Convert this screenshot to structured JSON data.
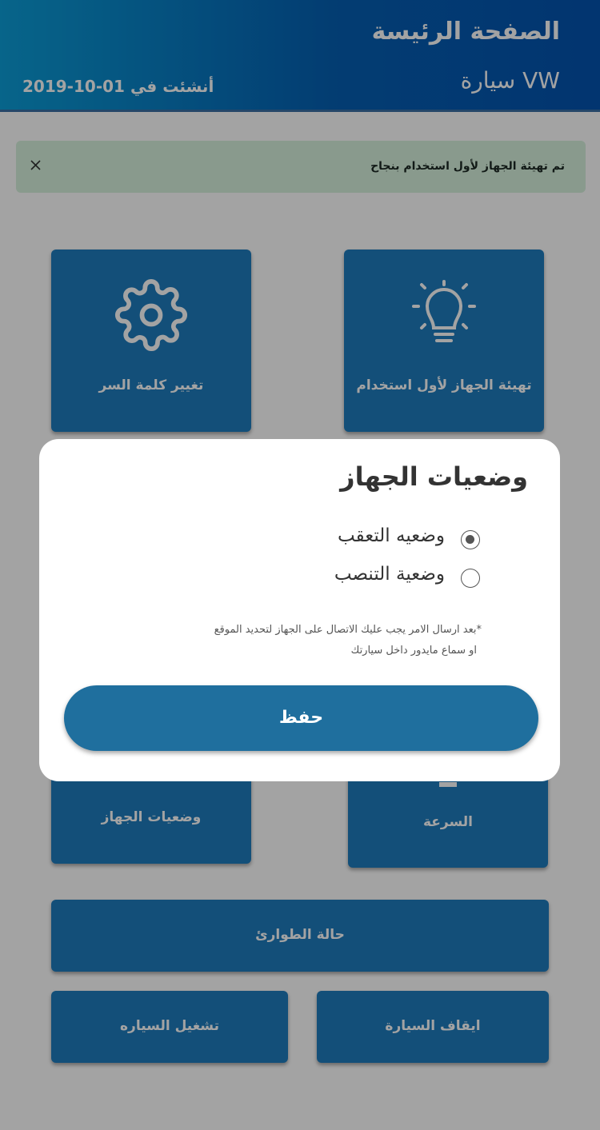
{
  "header": {
    "title": "الصفحة الرئيسة",
    "car": "سيارة VW",
    "created": "أنشئت في  01-10-2019"
  },
  "alert": {
    "message": "تم تهيئة الجهاز لأول استخدام بنجاح",
    "close_icon": "close-icon"
  },
  "tiles": {
    "change_password": "تغيير كلمة السر",
    "init_device": "تهيئة الجهاز لأول استخدام",
    "device_modes": "وضعيات الجهاز",
    "speed": "السرعة",
    "emergency": "حالة الطوارئ",
    "start_car": "تشغيل السياره",
    "stop_car": "ايقاف السيارة"
  },
  "icons": {
    "settings": "gear-icon",
    "bulb": "lightbulb-icon"
  },
  "modal": {
    "title": "وضعيات الجهاز",
    "options": [
      {
        "label": "وضعيه التعقب",
        "selected": true
      },
      {
        "label": "وضعية التنصب",
        "selected": false
      }
    ],
    "note_line1": "*بعد ارسال الامر يجب عليك الاتصال على الجهاز لتحديد الموقع",
    "note_line2": "او سماع مايدور داخل سيارتك",
    "save_label": "حفظ"
  },
  "colors": {
    "tile": "#1f7cbe",
    "save_button": "#1f6f9e",
    "alert_bg": "#d6f1dd"
  }
}
